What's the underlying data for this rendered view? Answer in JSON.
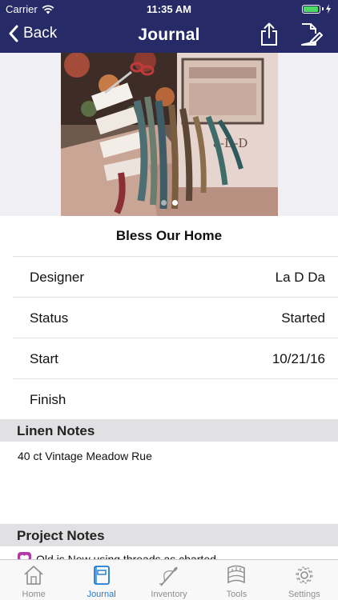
{
  "status_bar": {
    "carrier": "Carrier",
    "time": "11:35 AM",
    "battery_level": 0.95
  },
  "nav": {
    "back_label": "Back",
    "title": "Journal"
  },
  "photo": {
    "page_count": 2,
    "active_page": 2,
    "chart_lettering": "a-D-D"
  },
  "project": {
    "title": "Bless Our Home"
  },
  "details": [
    {
      "label": "Designer",
      "value": "La D Da"
    },
    {
      "label": "Status",
      "value": "Started"
    },
    {
      "label": "Start",
      "value": "10/21/16"
    },
    {
      "label": "Finish",
      "value": ""
    }
  ],
  "linen_notes": {
    "header": "Linen Notes",
    "text": "40 ct Vintage Meadow Rue"
  },
  "project_notes": {
    "header": "Project Notes",
    "text": "Old is New using threads as charted"
  },
  "tabbar": {
    "items": [
      {
        "label": "Home",
        "icon": "home-icon"
      },
      {
        "label": "Journal",
        "icon": "journal-icon"
      },
      {
        "label": "Inventory",
        "icon": "needle-icon"
      },
      {
        "label": "Tools",
        "icon": "ruler-icon"
      },
      {
        "label": "Settings",
        "icon": "gear-icon"
      }
    ],
    "active_index": 1
  },
  "colors": {
    "nav_bg": "#262a66",
    "section_bg": "#e1e1e4",
    "active_tab": "#1d7bd3",
    "inactive_tab": "#8e8e93"
  }
}
